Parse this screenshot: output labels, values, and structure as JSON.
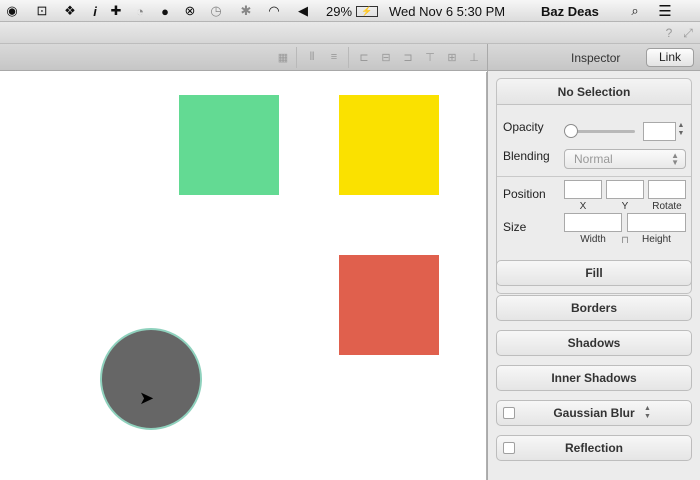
{
  "menubar": {
    "icons": [
      "record-icon",
      "stop-icon",
      "dropbox-icon",
      "info-icon",
      "plus-icon",
      "gauge-icon",
      "chat-icon",
      "close-circle-icon",
      "time-machine-icon",
      "bluetooth-icon",
      "wifi-icon",
      "volume-icon"
    ],
    "battery_percent": "29%",
    "datetime": "Wed Nov 6  5:30 PM",
    "user": "Baz Deas"
  },
  "inspector": {
    "title": "Inspector",
    "link_label": "Link",
    "panel_title": "No Selection",
    "opacity_label": "Opacity",
    "blending_label": "Blending",
    "blending_value": "Normal",
    "position_label": "Position",
    "x_label": "X",
    "y_label": "Y",
    "rotate_label": "Rotate",
    "size_label": "Size",
    "width_label": "Width",
    "height_label": "Height",
    "sections": [
      "Fill",
      "Borders",
      "Shadows",
      "Inner Shadows",
      "Gaussian Blur",
      "Reflection"
    ]
  },
  "canvas": {
    "shapes": [
      {
        "type": "rect",
        "color": "#63da93"
      },
      {
        "type": "rect",
        "color": "#fae100"
      },
      {
        "type": "rect",
        "color": "#e0604d"
      },
      {
        "type": "circle",
        "color": "#666666",
        "stroke": "#8fd1bd"
      }
    ]
  }
}
